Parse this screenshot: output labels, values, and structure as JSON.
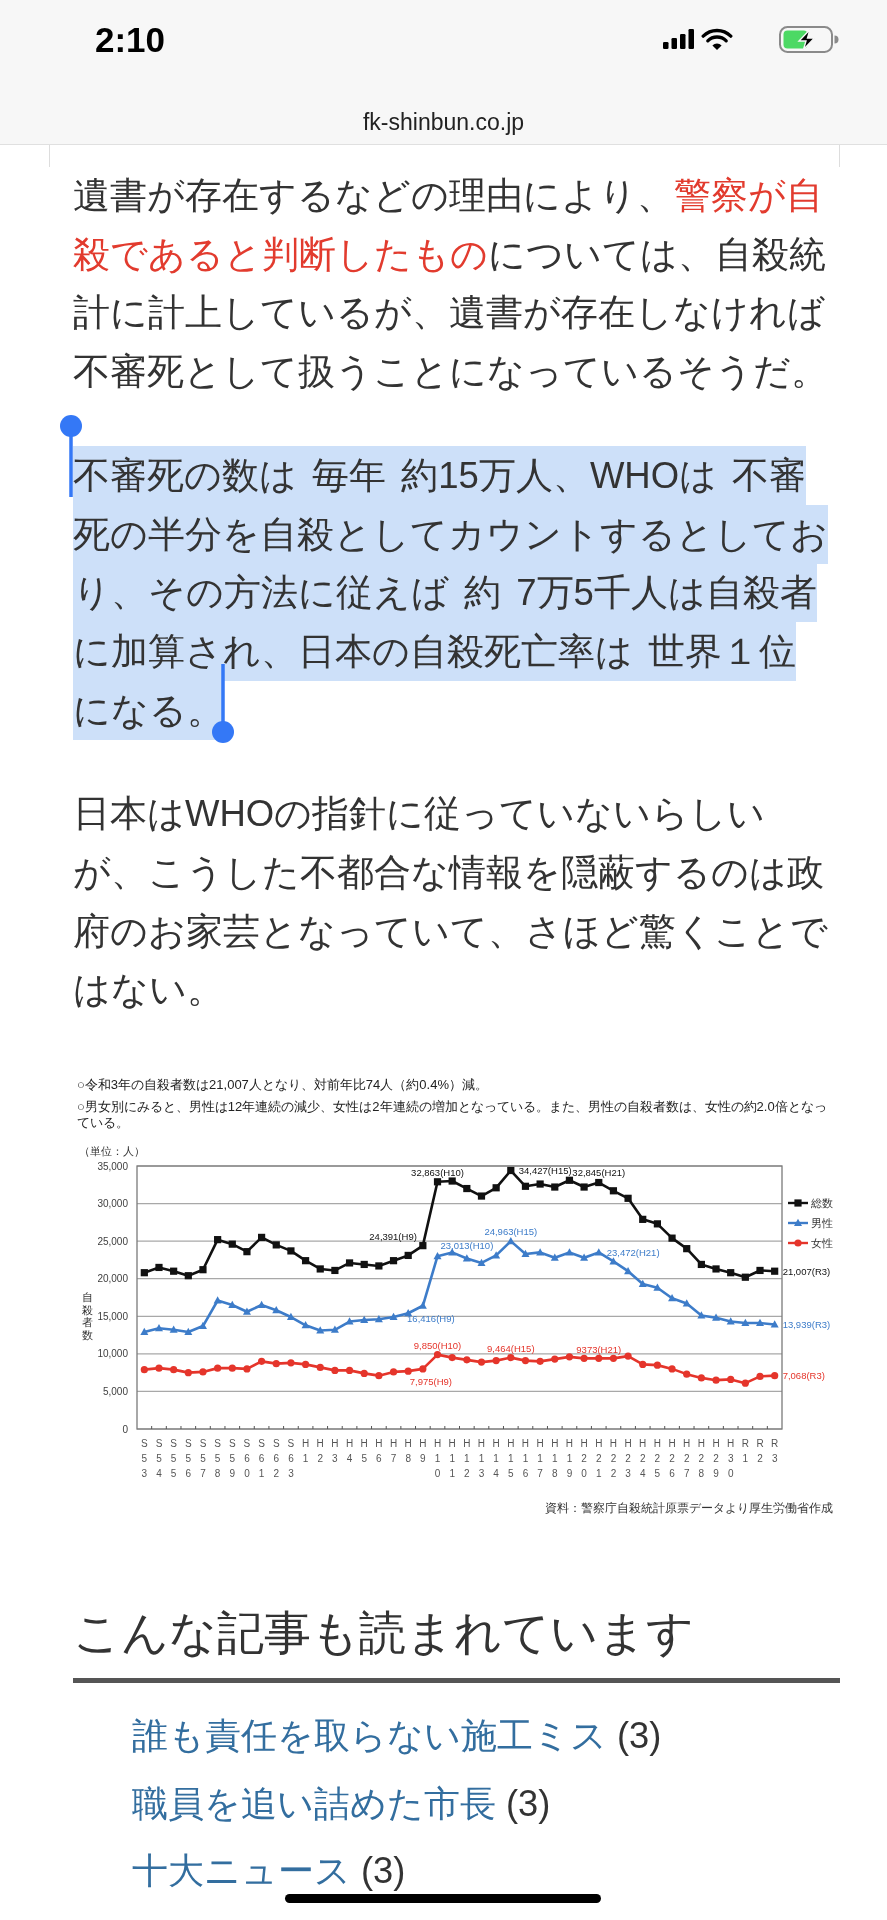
{
  "status_bar": {
    "time": "2:10"
  },
  "address_bar": {
    "url": "fk-shinbun.co.jp"
  },
  "article": {
    "paragraphs": [
      {
        "selected": false,
        "segments": [
          {
            "text": "遺書が存在するなどの理由により、",
            "emphasis": false
          },
          {
            "text": "警察が自殺であると判断したもの",
            "emphasis": true
          },
          {
            "text": "については、自殺統計に計上しているが、遺書が存在しなければ不審死として扱うことになっているそうだ。",
            "emphasis": false
          }
        ]
      },
      {
        "selected": true,
        "segments": [
          {
            "text": "不審死の数は 毎年 約15万人、WHOは 不審死の半分を自殺としてカウントするとしており、その方法に従えば 約 7万5千人は自殺者に加算され、日本の自殺死亡率は 世界１位になる。",
            "emphasis": false
          }
        ]
      },
      {
        "selected": false,
        "segments": [
          {
            "text": "日本はWHOの指針に従っていないらしいが、こうした不都合な情報を隠蔽するのは政府のお家芸となっていて、さほど驚くことではない。",
            "emphasis": false
          }
        ]
      }
    ],
    "figure": {
      "notes": [
        "○令和3年の自殺者数は21,007人となり、対前年比74人（約0.4%）減。",
        "○男女別にみると、男性は12年連続の減少、女性は2年連続の増加となっている。また、男性の自殺者数は、女性の約2.0倍となっている。"
      ],
      "unit": "（単位：人）",
      "source": "資料：警察庁自殺統計原票データより厚生労働省作成",
      "chart_data": {
        "type": "line",
        "ylabel": "自殺者数",
        "categories": [
          "S53",
          "S54",
          "S55",
          "S56",
          "S57",
          "S58",
          "S59",
          "S60",
          "S61",
          "S62",
          "S63",
          "H1",
          "H2",
          "H3",
          "H4",
          "H5",
          "H6",
          "H7",
          "H8",
          "H9",
          "H10",
          "H11",
          "H12",
          "H13",
          "H14",
          "H15",
          "H16",
          "H17",
          "H18",
          "H19",
          "H20",
          "H21",
          "H22",
          "H23",
          "H24",
          "H25",
          "H26",
          "H27",
          "H28",
          "H29",
          "H30",
          "R1",
          "R2",
          "R3"
        ],
        "series": [
          {
            "name": "総数",
            "color": "#111111",
            "marker": "square",
            "values": [
              20800,
              21500,
              21000,
              20400,
              21200,
              25200,
              24600,
              23600,
              25500,
              24500,
              23700,
              22400,
              21300,
              21100,
              22100,
              21900,
              21700,
              22400,
              23100,
              24400,
              32900,
              33000,
              32000,
              31000,
              32100,
              34400,
              32300,
              32600,
              32200,
              33100,
              32200,
              32800,
              31700,
              30700,
              27900,
              27300,
              25400,
              24000,
              21900,
              21300,
              20800,
              20200,
              21100,
              21000
            ]
          },
          {
            "name": "男性",
            "color": "#3d7cc9",
            "marker": "triangle",
            "values": [
              12900,
              13400,
              13200,
              12900,
              13700,
              17100,
              16500,
              15600,
              16500,
              15800,
              14900,
              13800,
              13100,
              13200,
              14300,
              14500,
              14600,
              14900,
              15400,
              16400,
              23000,
              23500,
              22700,
              22100,
              23100,
              25000,
              23300,
              23500,
              22800,
              23500,
              22800,
              23500,
              22300,
              21000,
              19300,
              18800,
              17400,
              16700,
              15100,
              14800,
              14300,
              14100,
              14100,
              13900
            ]
          },
          {
            "name": "女性",
            "color": "#e5352b",
            "marker": "circle",
            "values": [
              7900,
              8100,
              7900,
              7500,
              7600,
              8100,
              8100,
              8000,
              9000,
              8700,
              8800,
              8600,
              8200,
              7800,
              7800,
              7400,
              7100,
              7600,
              7700,
              8000,
              9900,
              9500,
              9200,
              8900,
              9100,
              9500,
              9100,
              9000,
              9300,
              9600,
              9400,
              9400,
              9400,
              9700,
              8600,
              8500,
              8000,
              7300,
              6800,
              6500,
              6600,
              6100,
              7000,
              7100
            ]
          }
        ],
        "ylim": [
          0,
          35000
        ],
        "yticks": [
          {
            "value": 0,
            "label": "0"
          },
          {
            "value": 5000,
            "label": "5,000"
          },
          {
            "value": 10000,
            "label": "10,000"
          },
          {
            "value": 15000,
            "label": "15,000"
          },
          {
            "value": 20000,
            "label": "20,000"
          },
          {
            "value": 25000,
            "label": "25,000"
          },
          {
            "value": 30000,
            "label": "30,000"
          },
          {
            "value": 35000,
            "label": "35,000"
          }
        ],
        "grid": true,
        "legend": "right",
        "annotations": [
          {
            "text": "32,863(H10)",
            "x": "H10",
            "y": 32863
          },
          {
            "text": "24,391(H9)",
            "x": "H9",
            "y": 24391
          },
          {
            "text": "34,427(H15)",
            "x": "H15",
            "y": 34427
          },
          {
            "text": "32,845(H21)",
            "x": "H21",
            "y": 32845
          },
          {
            "text": "21,007(R3)",
            "x": "R3",
            "y": 21007
          },
          {
            "text": "23,013(H10)",
            "x": "H10",
            "y": 23013
          },
          {
            "text": "16,416(H9)",
            "x": "H9",
            "y": 16416
          },
          {
            "text": "24,963(H15)",
            "x": "H15",
            "y": 24963
          },
          {
            "text": "23,472(H21)",
            "x": "H21",
            "y": 23472
          },
          {
            "text": "13,939(R3)",
            "x": "R3",
            "y": 13939
          },
          {
            "text": "9,850(H10)",
            "x": "H10",
            "y": 9850
          },
          {
            "text": "7,975(H9)",
            "x": "H9",
            "y": 7975
          },
          {
            "text": "9,464(H15)",
            "x": "H15",
            "y": 9464
          },
          {
            "text": "9373(H21)",
            "x": "H21",
            "y": 9373
          },
          {
            "text": "7,068(R3)",
            "x": "R3",
            "y": 7068
          }
        ]
      }
    }
  },
  "related": {
    "heading": "こんな記事も読まれています",
    "items": [
      {
        "title": "誰も責任を取らない施工ミス",
        "count": "(3)"
      },
      {
        "title": "職員を追い詰めた市長",
        "count": "(3)"
      },
      {
        "title": "十大ニュース",
        "count": "(3)"
      }
    ]
  }
}
